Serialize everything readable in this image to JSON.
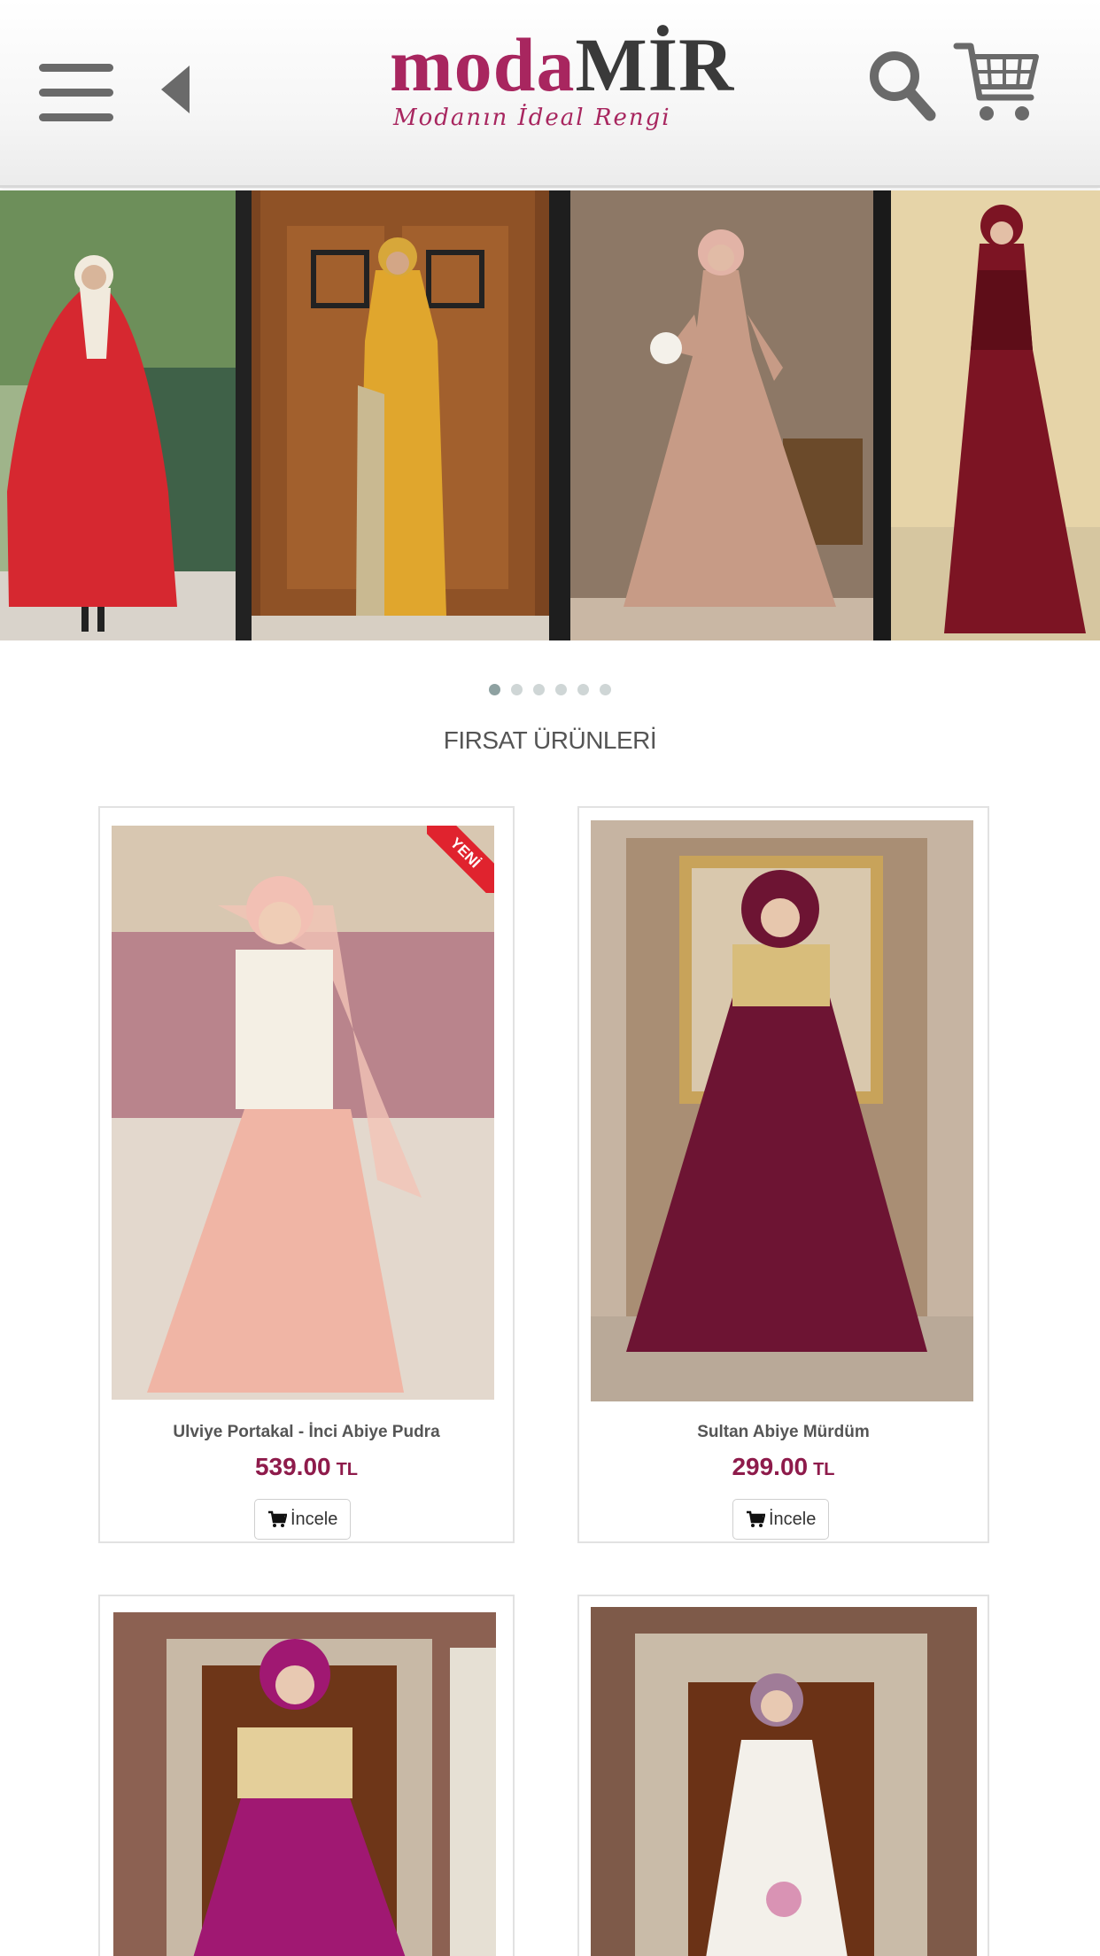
{
  "header": {
    "logo_main_a": "moda",
    "logo_main_b": "MİR",
    "logo_tagline": "Modanın İdeal Rengi",
    "icons": [
      "hamburger-menu-icon",
      "back-arrow-icon",
      "search-icon",
      "cart-icon"
    ]
  },
  "slider": {
    "slides": [
      "red cape dress",
      "mustard dress",
      "pink satin gown",
      "burgundy sequin gown"
    ],
    "dot_count": 6,
    "active_index": 0
  },
  "section": {
    "title": "FIRSAT ÜRÜNLERİ"
  },
  "products": [
    {
      "name": "Ulviye Portakal - İnci Abiye Pudra",
      "price": "539.00",
      "currency": "TL",
      "button": "İncele",
      "badge": "YENİ"
    },
    {
      "name": "Sultan Abiye Mürdüm",
      "price": "299.00",
      "currency": "TL",
      "button": "İncele",
      "badge": ""
    },
    {
      "name": "",
      "price": "",
      "currency": "",
      "button": "",
      "badge": ""
    },
    {
      "name": "",
      "price": "",
      "currency": "",
      "button": "",
      "badge": ""
    }
  ],
  "colors": {
    "brand": "#a8265f",
    "price": "#8e1b4b",
    "badge": "#e0232e"
  }
}
